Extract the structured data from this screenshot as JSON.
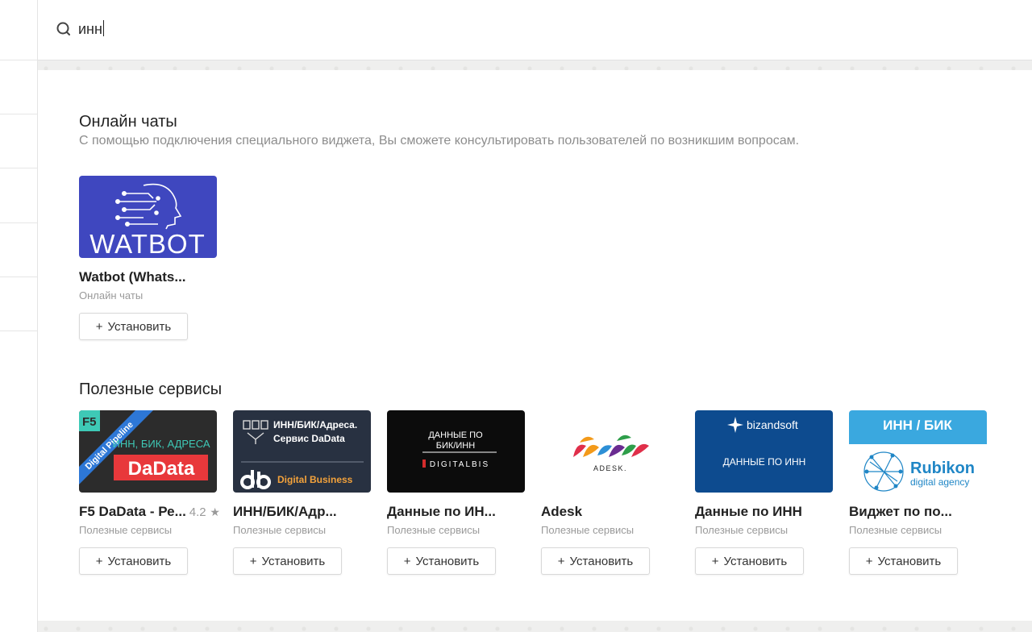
{
  "search": {
    "query": "инн",
    "icon": "search-icon"
  },
  "sections": [
    {
      "title": "Онлайн чаты",
      "description": "С помощью подключения специального виджета, Вы сможете консультировать пользователей по возникшим вопросам.",
      "cards": [
        {
          "title": "Watbot (Whats...",
          "category": "Онлайн чаты",
          "button": "Установить",
          "logo_text": "WATBOT"
        }
      ]
    },
    {
      "title": "Полезные сервисы",
      "cards": [
        {
          "title": "F5 DaData - Ре...",
          "rating": "4.2",
          "category": "Полезные сервисы",
          "button": "Установить",
          "logo": {
            "corner": "F5",
            "ribbon": "Digital Pipeline",
            "line1": "ИНН, БИК, АДРЕСА",
            "line2": "DaData"
          }
        },
        {
          "title": "ИНН/БИК/Адр...",
          "category": "Полезные сервисы",
          "button": "Установить",
          "logo": {
            "line1": "ИНН/БИК/Адреса.",
            "line2": "Сервис DaData",
            "brand": "Digital Business"
          }
        },
        {
          "title": "Данные по ИН...",
          "category": "Полезные сервисы",
          "button": "Установить",
          "logo": {
            "line1": "ДАННЫЕ ПО",
            "line2": "БИК/ИНН",
            "brand": "DIGITALBIS"
          }
        },
        {
          "title": "Adesk",
          "category": "Полезные сервисы",
          "button": "Установить",
          "logo": {
            "brand": "ADESK."
          }
        },
        {
          "title": "Данные по ИНН",
          "category": "Полезные сервисы",
          "button": "Установить",
          "logo": {
            "brand": "bizandsoft",
            "line1": "ДАННЫЕ ПО ИНН"
          }
        },
        {
          "title": "Виджет по по...",
          "category": "Полезные сервисы",
          "button": "Установить",
          "logo": {
            "banner": "ИНН / БИК",
            "brand": "Rubikon",
            "tagline": "digital agency"
          }
        }
      ]
    }
  ],
  "colors": {
    "watbot_bg": "#3f47bf",
    "dadata_bg": "#2c2c2c",
    "dadata_red": "#e8383b",
    "digitalbusiness_bg": "#283141",
    "digitalbis_bg": "#0c0c0c",
    "bizandsoft_bg": "#0d4b8f",
    "rubikon_banner": "#3aa8df",
    "rubikon_blue": "#1f86c6"
  }
}
